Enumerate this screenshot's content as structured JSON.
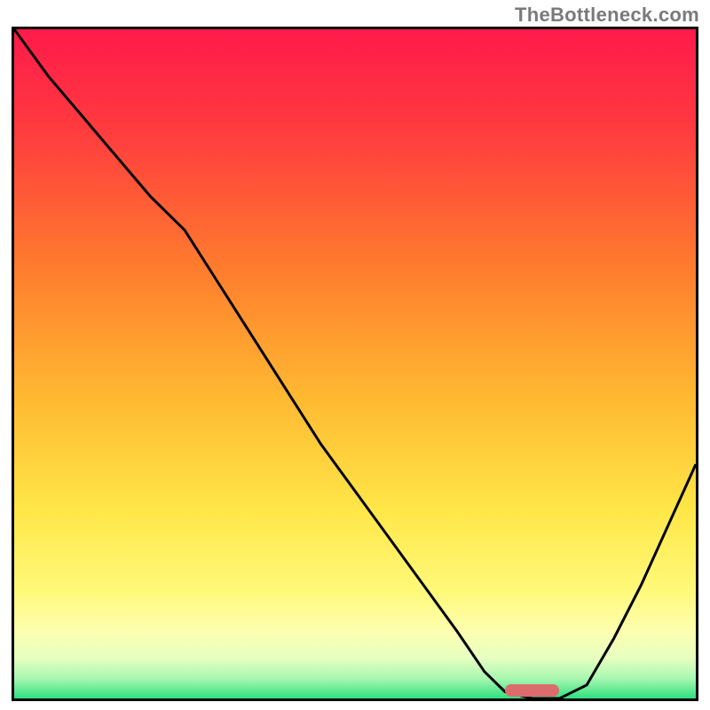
{
  "watermark": "TheBottleneck.com",
  "colors": {
    "frame_border": "#000000",
    "curve_stroke": "#000000",
    "marker_fill": "#dc6b6e",
    "gradient_stops": [
      {
        "offset": 0.0,
        "color": "#ff1a4b"
      },
      {
        "offset": 0.15,
        "color": "#ff3b3f"
      },
      {
        "offset": 0.35,
        "color": "#ff7a2e"
      },
      {
        "offset": 0.55,
        "color": "#ffb931"
      },
      {
        "offset": 0.72,
        "color": "#ffe748"
      },
      {
        "offset": 0.84,
        "color": "#fff97a"
      },
      {
        "offset": 0.9,
        "color": "#fdffb0"
      },
      {
        "offset": 0.94,
        "color": "#e6ffc0"
      },
      {
        "offset": 0.97,
        "color": "#a9f7b1"
      },
      {
        "offset": 1.0,
        "color": "#2fe07f"
      }
    ]
  },
  "chart_data": {
    "type": "line",
    "title": "",
    "xlabel": "",
    "ylabel": "",
    "xlim": [
      0,
      100
    ],
    "ylim": [
      0,
      100
    ],
    "grid": false,
    "legend": false,
    "series": [
      {
        "name": "bottleneck-curve",
        "x": [
          0,
          5,
          10,
          15,
          20,
          25,
          30,
          35,
          40,
          45,
          50,
          55,
          60,
          65,
          69,
          72,
          76,
          80,
          84,
          88,
          92,
          96,
          100
        ],
        "y": [
          100,
          93,
          87,
          81,
          75,
          70,
          62,
          54,
          46,
          38,
          31,
          24,
          17,
          10,
          4,
          1,
          0,
          0,
          2,
          9,
          17,
          26,
          35
        ]
      }
    ],
    "annotations": [
      {
        "name": "optimal-marker",
        "x_start": 72,
        "x_end": 80,
        "y": 0
      }
    ],
    "notes": "y represents bottleneck percentage (higher = worse, red at top → green at bottom). Values estimated from pixel positions; chart has no numeric axis labels."
  }
}
